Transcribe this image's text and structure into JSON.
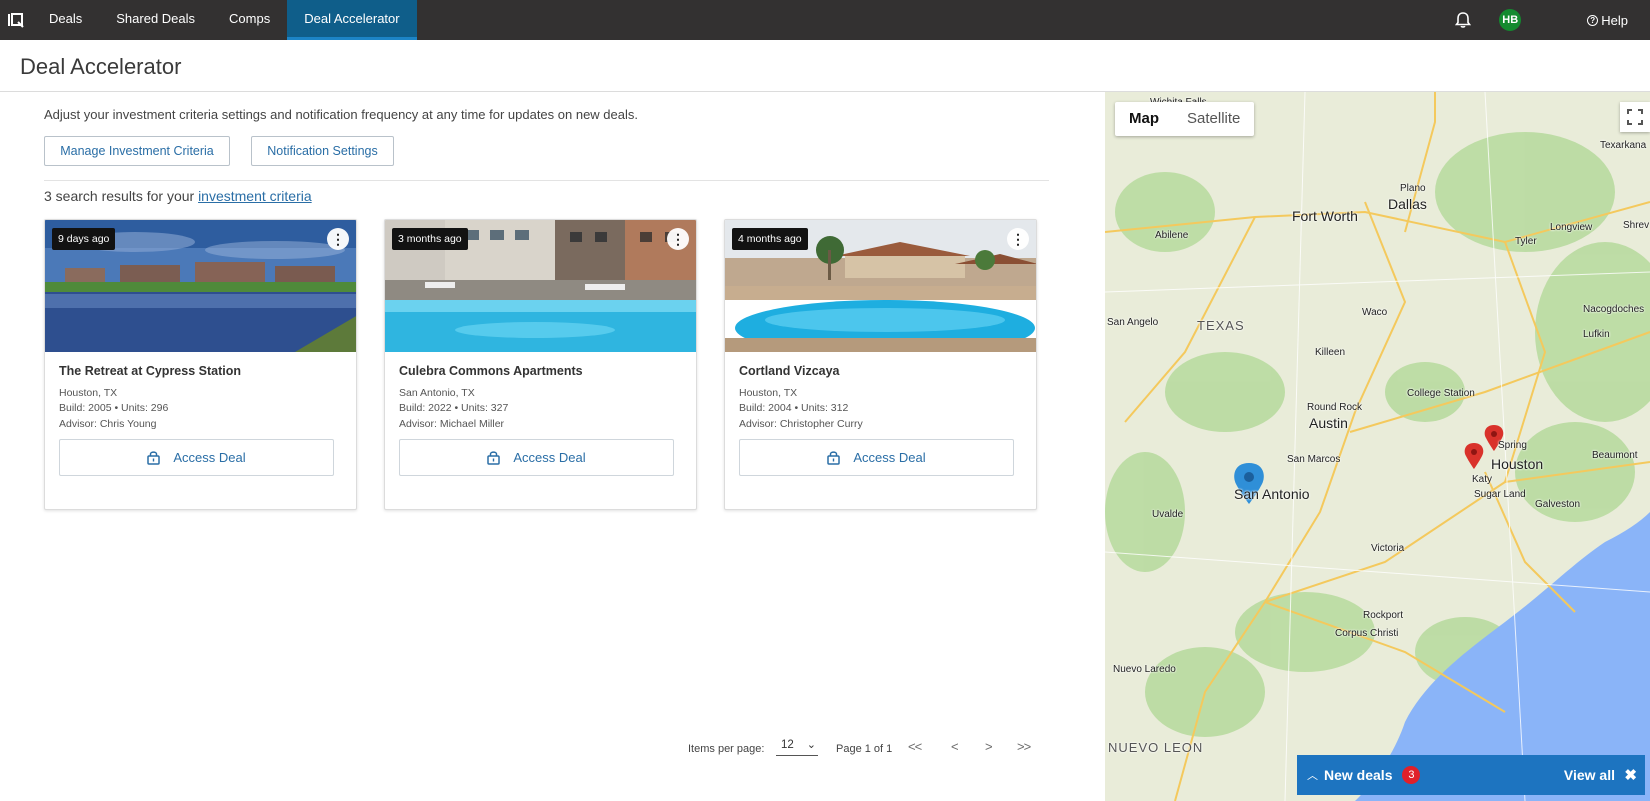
{
  "nav": {
    "logo": "IQ",
    "items": [
      {
        "label": "Deals"
      },
      {
        "label": "Shared Deals"
      },
      {
        "label": "Comps"
      },
      {
        "label": "Deal Accelerator"
      }
    ],
    "active_item": "Deal Accelerator",
    "user_initials": "HB",
    "help_label": "Help"
  },
  "page": {
    "title": "Deal Accelerator"
  },
  "criteria": {
    "intro": "Adjust your investment criteria settings and notification frequency at any time for updates on new deals.",
    "manage_button": "Manage Investment Criteria",
    "notification_button": "Notification Settings",
    "results_prefix": "3 search results for your ",
    "results_link": "investment criteria"
  },
  "deals": [
    {
      "age": "9 days ago",
      "name": "The Retreat at Cypress Station",
      "location": "Houston, TX",
      "build_units": "Build: 2005 • Units: 296",
      "advisor": "Advisor: Chris Young",
      "action": "Access Deal"
    },
    {
      "age": "3 months ago",
      "name": "Culebra Commons Apartments",
      "location": "San Antonio, TX",
      "build_units": "Build: 2022 • Units: 327",
      "advisor": "Advisor: Michael Miller",
      "action": "Access Deal"
    },
    {
      "age": "4 months ago",
      "name": "Cortland Vizcaya",
      "location": "Houston, TX",
      "build_units": "Build: 2004 • Units: 312",
      "advisor": "Advisor: Christopher Curry",
      "action": "Access Deal"
    }
  ],
  "pagination": {
    "items_per_page_label": "Items per page:",
    "items_per_page_value": "12",
    "page_info": "Page 1 of 1",
    "first": "<<",
    "prev": "<",
    "next": ">",
    "last": ">>"
  },
  "map": {
    "mode_map": "Map",
    "mode_satellite": "Satellite",
    "active_mode": "Map",
    "labels": [
      {
        "text": "Wichita Falls"
      },
      {
        "text": "Plano"
      },
      {
        "text": "Dallas"
      },
      {
        "text": "Fort Worth"
      },
      {
        "text": "Texarkana"
      },
      {
        "text": "Abilene"
      },
      {
        "text": "Tyler"
      },
      {
        "text": "Longview"
      },
      {
        "text": "Shrev"
      },
      {
        "text": "Nacogdoches"
      },
      {
        "text": "San Angelo"
      },
      {
        "text": "TEXAS"
      },
      {
        "text": "Waco"
      },
      {
        "text": "Lufkin"
      },
      {
        "text": "Killeen"
      },
      {
        "text": "College Station"
      },
      {
        "text": "Round Rock"
      },
      {
        "text": "Austin"
      },
      {
        "text": "Spring"
      },
      {
        "text": "San Marcos"
      },
      {
        "text": "Houston"
      },
      {
        "text": "Beaumont"
      },
      {
        "text": "San Antonio"
      },
      {
        "text": "Katy"
      },
      {
        "text": "Sugar Land"
      },
      {
        "text": "Galveston"
      },
      {
        "text": "Uvalde"
      },
      {
        "text": "Victoria"
      },
      {
        "text": "Rockport"
      },
      {
        "text": "Corpus Christi"
      },
      {
        "text": "Nuevo Laredo"
      },
      {
        "text": "NUEVO LEON"
      }
    ],
    "markers": [
      {
        "city": "San Antonio",
        "color": "#2f8fd8"
      },
      {
        "city": "Spring",
        "color": "#d9322b"
      },
      {
        "city": "Houston",
        "color": "#d9322b"
      }
    ]
  },
  "new_deals": {
    "label": "New deals",
    "count": "3",
    "view_all": "View all",
    "accent": "#1d74c0"
  },
  "colors": {
    "topbar": "#333131",
    "active_tab": "#0f5e8a",
    "link": "#2a6ea6"
  }
}
